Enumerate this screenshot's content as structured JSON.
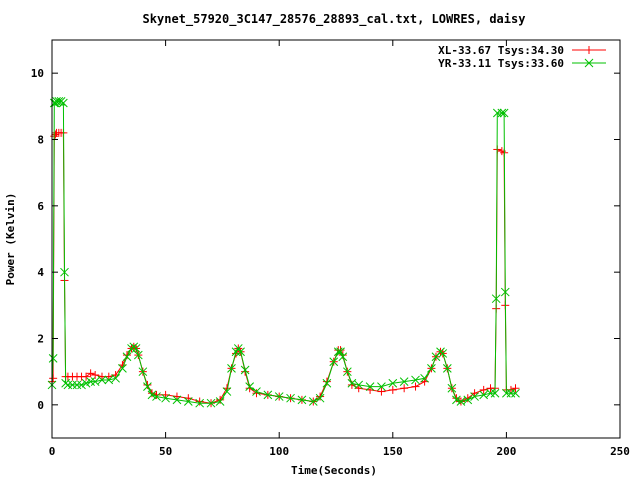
{
  "chart_data": {
    "type": "line",
    "title": "Skynet_57920_3C147_28576_28893_cal.txt, LOWRES, daisy",
    "xlabel": "Time(Seconds)",
    "ylabel": "Power (Kelvin)",
    "xlim": [
      0,
      250
    ],
    "ylim": [
      -1,
      11
    ],
    "xticks": [
      0,
      50,
      100,
      150,
      200,
      250
    ],
    "yticks": [
      0,
      2,
      4,
      6,
      8,
      10
    ],
    "grid": false,
    "legend_position": "top-right",
    "series": [
      {
        "name": "XL-33.67 Tsys:34.30",
        "color": "#ff0000",
        "marker": "plus",
        "x": [
          0,
          0.5,
          1,
          1.5,
          2,
          3,
          4,
          5,
          5.5,
          6,
          7,
          9,
          11,
          13,
          15,
          17,
          19,
          22,
          25,
          28,
          31,
          33,
          35,
          36,
          37,
          38,
          40,
          42,
          44,
          46,
          50,
          55,
          60,
          65,
          70,
          74,
          77,
          79,
          81,
          82,
          83,
          85,
          87,
          90,
          95,
          100,
          105,
          110,
          115,
          118,
          121,
          124,
          126,
          127,
          128,
          130,
          132,
          135,
          140,
          145,
          150,
          155,
          160,
          164,
          167,
          169,
          171,
          172,
          174,
          176,
          178,
          180,
          183,
          186,
          190,
          193,
          195,
          195.5,
          196,
          198,
          199,
          199.5,
          200,
          202,
          204
        ],
        "y": [
          0.7,
          0.8,
          8.1,
          8.15,
          8.2,
          8.2,
          8.2,
          8.2,
          3.75,
          0.85,
          0.85,
          0.85,
          0.85,
          0.85,
          0.85,
          0.95,
          0.9,
          0.85,
          0.85,
          0.9,
          1.2,
          1.5,
          1.7,
          1.75,
          1.7,
          1.5,
          1.0,
          0.6,
          0.35,
          0.3,
          0.3,
          0.25,
          0.2,
          0.1,
          0.05,
          0.15,
          0.5,
          1.1,
          1.55,
          1.7,
          1.6,
          1.0,
          0.5,
          0.35,
          0.3,
          0.25,
          0.2,
          0.15,
          0.1,
          0.25,
          0.7,
          1.3,
          1.65,
          1.65,
          1.5,
          1.0,
          0.6,
          0.5,
          0.45,
          0.4,
          0.45,
          0.5,
          0.55,
          0.7,
          1.1,
          1.45,
          1.6,
          1.55,
          1.1,
          0.5,
          0.2,
          0.1,
          0.2,
          0.35,
          0.45,
          0.5,
          0.5,
          2.9,
          7.7,
          7.65,
          7.6,
          3.0,
          0.45,
          0.45,
          0.5
        ]
      },
      {
        "name": "YR-33.11 Tsys:33.60",
        "color": "#00c000",
        "marker": "cross",
        "x": [
          0,
          0.5,
          1,
          1.5,
          2,
          3,
          4,
          5,
          5.5,
          6,
          7,
          9,
          11,
          13,
          15,
          17,
          19,
          22,
          25,
          28,
          31,
          33,
          35,
          36,
          37,
          38,
          40,
          42,
          44,
          46,
          50,
          55,
          60,
          65,
          70,
          74,
          77,
          79,
          81,
          82,
          83,
          85,
          87,
          90,
          95,
          100,
          105,
          110,
          115,
          118,
          121,
          124,
          126,
          127,
          128,
          130,
          132,
          135,
          140,
          145,
          150,
          155,
          160,
          164,
          167,
          169,
          171,
          172,
          174,
          176,
          178,
          180,
          183,
          186,
          190,
          193,
          195,
          195.5,
          196,
          198,
          199,
          199.5,
          200,
          202,
          204
        ],
        "y": [
          0.6,
          1.4,
          9.1,
          9.1,
          9.15,
          9.15,
          9.15,
          9.1,
          4.0,
          0.65,
          0.6,
          0.6,
          0.6,
          0.6,
          0.65,
          0.7,
          0.7,
          0.75,
          0.75,
          0.8,
          1.1,
          1.45,
          1.7,
          1.75,
          1.7,
          1.5,
          1.0,
          0.55,
          0.3,
          0.25,
          0.2,
          0.15,
          0.1,
          0.05,
          0.05,
          0.1,
          0.4,
          1.1,
          1.6,
          1.7,
          1.6,
          1.05,
          0.55,
          0.4,
          0.3,
          0.25,
          0.2,
          0.15,
          0.1,
          0.2,
          0.65,
          1.3,
          1.6,
          1.6,
          1.45,
          1.0,
          0.65,
          0.6,
          0.55,
          0.55,
          0.65,
          0.7,
          0.75,
          0.8,
          1.1,
          1.45,
          1.6,
          1.55,
          1.1,
          0.5,
          0.15,
          0.1,
          0.15,
          0.25,
          0.3,
          0.35,
          0.35,
          3.2,
          8.8,
          8.8,
          8.8,
          3.4,
          0.35,
          0.35,
          0.35
        ]
      }
    ]
  }
}
